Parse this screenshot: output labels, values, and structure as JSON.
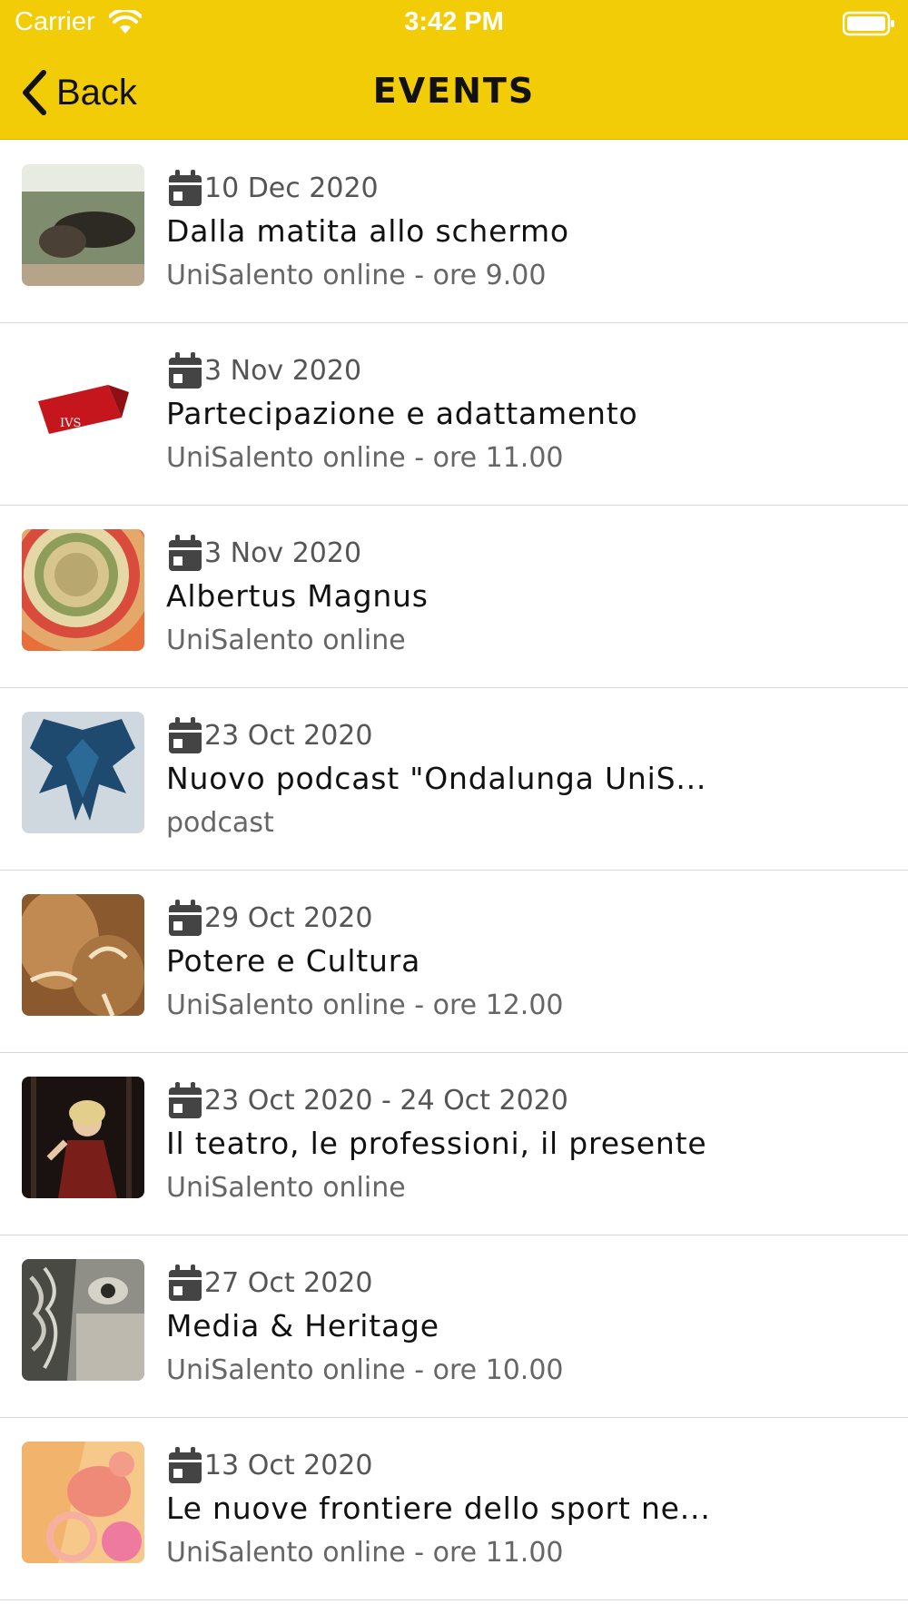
{
  "status_bar": {
    "carrier": "Carrier",
    "time": "3:42 PM"
  },
  "nav": {
    "back_label": "Back",
    "title": "EVENTS"
  },
  "events": [
    {
      "date": "10 Dec 2020",
      "title": "Dalla matita allo schermo",
      "subtitle": "UniSalento online - ore 9.00"
    },
    {
      "date": "3 Nov 2020",
      "title": "Partecipazione e adattamento",
      "subtitle": "UniSalento online - ore 11.00"
    },
    {
      "date": "3 Nov 2020",
      "title": "Albertus Magnus",
      "subtitle": "UniSalento online"
    },
    {
      "date": "23 Oct 2020",
      "title": "Nuovo podcast \"Ondalunga UniS...",
      "subtitle": "podcast"
    },
    {
      "date": "29 Oct 2020",
      "title": "Potere e Cultura",
      "subtitle": "UniSalento online - ore 12.00"
    },
    {
      "date": "23 Oct 2020 - 24 Oct 2020",
      "title": "Il teatro, le professioni, il presente",
      "subtitle": "UniSalento online"
    },
    {
      "date": "27 Oct 2020",
      "title": "Media & Heritage",
      "subtitle": "UniSalento online - ore 10.00"
    },
    {
      "date": "13 Oct 2020",
      "title": "Le nuove frontiere dello sport ne...",
      "subtitle": "UniSalento online - ore 11.00"
    }
  ],
  "colors": {
    "header": "#f2cc07",
    "separator": "#d6d6d6",
    "subtitle": "#666666"
  }
}
